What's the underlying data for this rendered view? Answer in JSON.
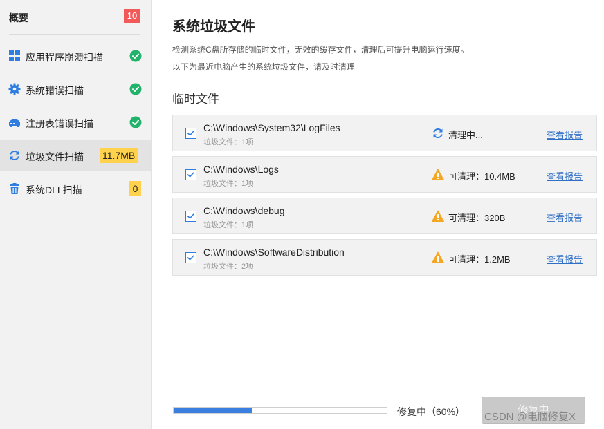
{
  "sidebar": {
    "overview": {
      "label": "概要",
      "badge": "10"
    },
    "items": [
      {
        "label": "应用程序崩溃扫描",
        "icon": "grid-icon",
        "status": "done"
      },
      {
        "label": "系统错误扫描",
        "icon": "gear-icon",
        "status": "done"
      },
      {
        "label": "注册表错误扫描",
        "icon": "registry-icon",
        "status": "done"
      },
      {
        "label": "垃圾文件扫描",
        "icon": "refresh-icon",
        "badge": "11.7MB",
        "active": true
      },
      {
        "label": "系统DLL扫描",
        "icon": "trash-icon",
        "badge": "0"
      }
    ]
  },
  "main": {
    "title": "系统垃圾文件",
    "desc1": "检测系统C盘所存储的临时文件，无效的缓存文件，清理后可提升电脑运行速度。",
    "desc2": "以下为最近电脑产生的系统垃圾文件，请及时清理",
    "section_title": "临时文件",
    "rows": [
      {
        "path": "C:\\Windows\\System32\\LogFiles",
        "sub": "垃圾文件：1项",
        "status_icon": "refresh-icon",
        "status": "清理中...",
        "link": "查看报告"
      },
      {
        "path": "C:\\Windows\\Logs",
        "sub": "垃圾文件：1项",
        "status_icon": "warning-icon",
        "status": "可清理：10.4MB",
        "link": "查看报告"
      },
      {
        "path": "C:\\Windows\\debug",
        "sub": "垃圾文件：1项",
        "status_icon": "warning-icon",
        "status": "可清理：320B",
        "link": "查看报告"
      },
      {
        "path": "C:\\Windows\\SoftwareDistribution",
        "sub": "垃圾文件：2项",
        "status_icon": "warning-icon",
        "status": "可清理：1.2MB",
        "link": "查看报告"
      }
    ]
  },
  "footer": {
    "progress_fraction": 0.6,
    "progress_text": "修复中（60%）",
    "button_label": "修复中"
  },
  "watermark": "CSDN @电脑修复X",
  "colors": {
    "accent": "#2f7de1",
    "check_green": "#22b36b",
    "badge_red": "#f25a5a",
    "badge_yellow": "#ffd24d",
    "warning": "#f5a623",
    "link": "#2f6fc6"
  }
}
